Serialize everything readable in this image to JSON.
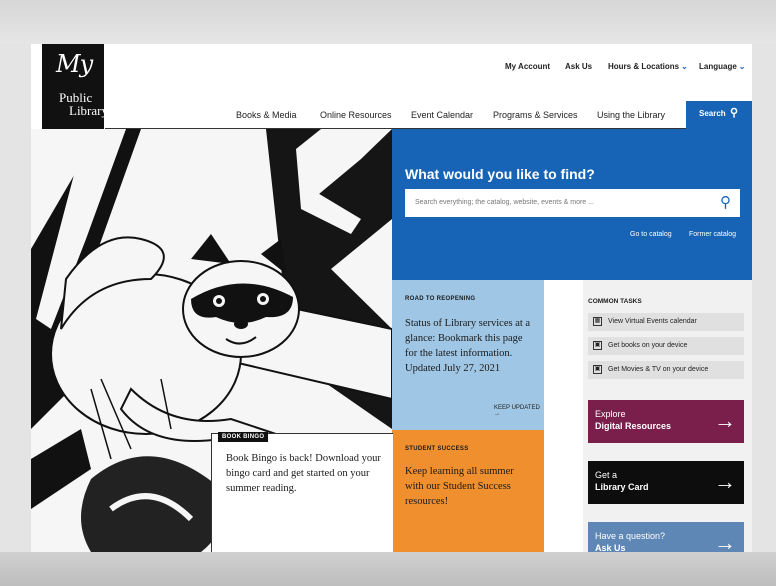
{
  "logo": {
    "line1": "My",
    "line2": "Public",
    "line3": "Library"
  },
  "utility": {
    "account": "My Account",
    "ask": "Ask Us",
    "hours": "Hours & Locations",
    "language": "Language"
  },
  "nav": {
    "items": [
      "Books & Media",
      "Online Resources",
      "Event Calendar",
      "Programs & Services",
      "Using the Library"
    ],
    "search_label": "Search"
  },
  "find": {
    "heading": "What would you like to find?",
    "placeholder": "Search everything; the catalog, website, events & more ...",
    "link_catalog": "Go to catalog",
    "link_former": "Former catalog"
  },
  "reopening": {
    "label": "ROAD TO REOPENING",
    "text": "Status of Library services at a glance: Bookmark this page for the latest information. Updated July 27, 2021",
    "cta": "KEEP UPDATED →"
  },
  "student": {
    "label": "STUDENT SUCCESS",
    "text": "Keep learning all summer with our Student Success resources!"
  },
  "tasks": {
    "title": "COMMON TASKS",
    "items": [
      "View Virtual Events calendar",
      "Get books on your device",
      "Get Movies & TV on your device"
    ]
  },
  "cards": {
    "explore": {
      "small": "Explore",
      "strong": "Digital Resources",
      "color": "#7a1f4b"
    },
    "card": {
      "small": "Get a",
      "strong": "Library Card",
      "color": "#0d0d0d"
    },
    "ask": {
      "small": "Have a question?",
      "strong": "Ask Us",
      "color": "#5f87b5"
    }
  },
  "bingo": {
    "label": "BOOK BINGO",
    "text": "Book Bingo is back! Download your bingo card and get started on your summer reading."
  }
}
